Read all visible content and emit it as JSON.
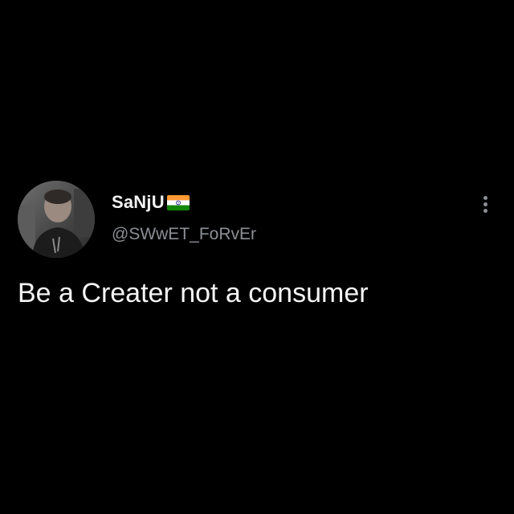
{
  "tweet": {
    "author": {
      "display_name": "SaNjU",
      "handle": "@SWwET_FoRvEr",
      "flag": "india-flag-icon"
    },
    "text": "Be a Creater not a consumer",
    "menu_icon": "more-vertical-icon"
  },
  "colors": {
    "background": "#000000",
    "text_primary": "#f5f5f5",
    "text_secondary": "#8b8f94",
    "flag_saffron": "#ff9933",
    "flag_white": "#ffffff",
    "flag_green": "#138808",
    "flag_chakra": "#000080"
  }
}
